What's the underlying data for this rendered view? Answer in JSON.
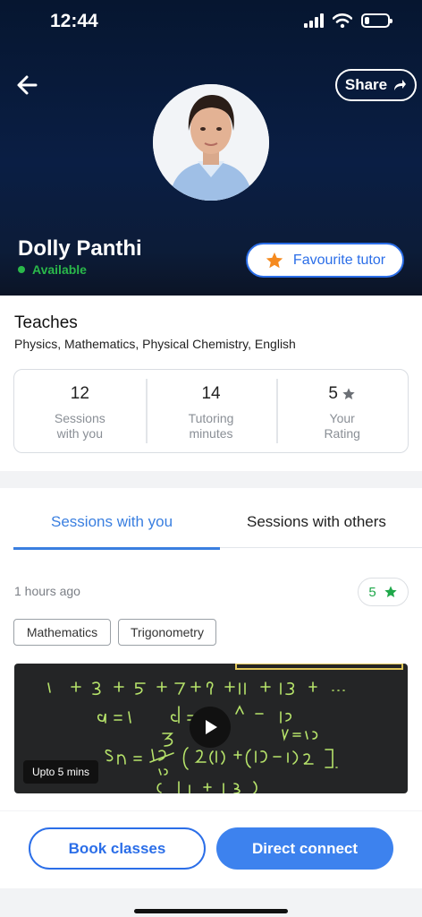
{
  "status_bar": {
    "time": "12:44"
  },
  "header": {
    "share_label": "Share",
    "tutor_name": "Dolly Panthi",
    "availability": "Available",
    "favourite_label": "Favourite tutor"
  },
  "teaches": {
    "title": "Teaches",
    "subjects": "Physics, Mathematics, Physical Chemistry, English"
  },
  "stats": [
    {
      "value": "12",
      "label": "Sessions\nwith you"
    },
    {
      "value": "14",
      "label": "Tutoring\nminutes"
    },
    {
      "value": "5",
      "label": "Your\nRating"
    }
  ],
  "tabs": {
    "active": "Sessions with you",
    "other": "Sessions with others"
  },
  "session": {
    "time_ago": "1 hours ago",
    "rating": "5",
    "tags": [
      "Mathematics",
      "Trigonometry"
    ],
    "video_duration": "Upto 5 mins"
  },
  "actions": {
    "book": "Book classes",
    "direct": "Direct connect"
  },
  "colors": {
    "primary": "#2b6ee8",
    "available": "#2ab84a",
    "star_orange": "#f58a1f",
    "rating_green": "#1fa84a",
    "header_bg": "#0a1e44"
  }
}
